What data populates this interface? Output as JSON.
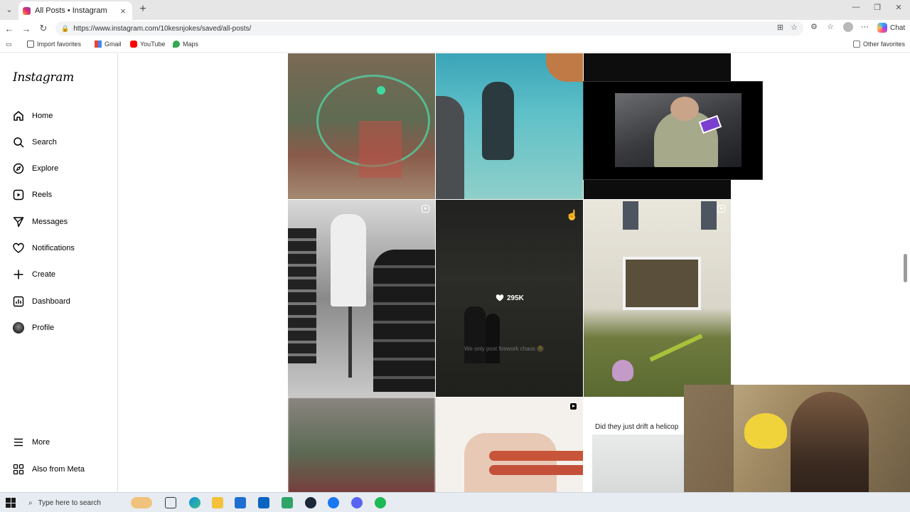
{
  "browser": {
    "tab_title": "All Posts • Instagram",
    "url": "https://www.instagram.com/10kesnjokes/saved/all-posts/",
    "copilot_label": "Chat"
  },
  "bookmarks": {
    "import": "Import favorites",
    "gmail": "Gmail",
    "youtube": "YouTube",
    "maps": "Maps",
    "other": "Other favorites"
  },
  "sidebar": {
    "logo": "Instagram",
    "items": [
      {
        "label": "Home",
        "icon": "home-icon"
      },
      {
        "label": "Search",
        "icon": "search-icon"
      },
      {
        "label": "Explore",
        "icon": "compass-icon"
      },
      {
        "label": "Reels",
        "icon": "reels-icon"
      },
      {
        "label": "Messages",
        "icon": "paper-plane-icon"
      },
      {
        "label": "Notifications",
        "icon": "heart-icon"
      },
      {
        "label": "Create",
        "icon": "plus-icon"
      },
      {
        "label": "Dashboard",
        "icon": "chart-icon"
      },
      {
        "label": "Profile",
        "icon": "avatar"
      }
    ],
    "more": "More",
    "also_from_meta": "Also from Meta"
  },
  "grid": {
    "likes_label": "295K",
    "caption_overlay": "We only post firework chaos 😂",
    "post_text": "Did they just drift a helicop"
  },
  "taskbar": {
    "search_placeholder": "Type here to search"
  }
}
